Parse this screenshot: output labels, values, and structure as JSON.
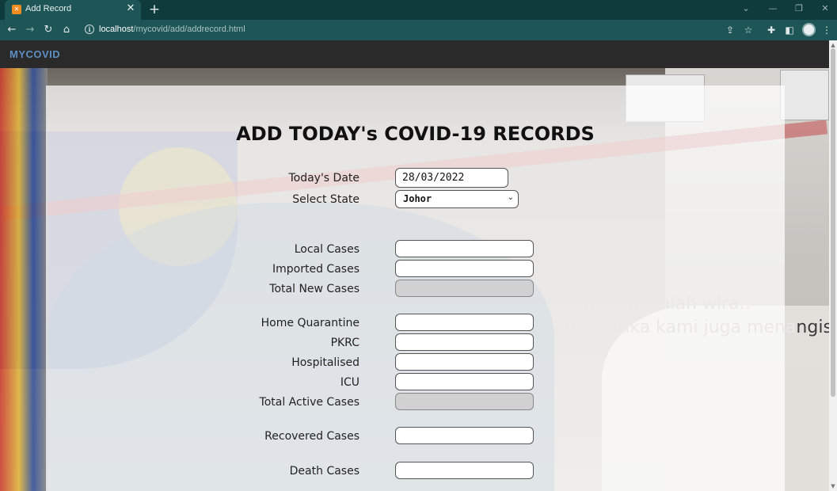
{
  "browser": {
    "tab_title": "Add Record",
    "tab_favicon": "xampp-icon",
    "url_host": "localhost",
    "url_path": "/mycovid/add/addrecord.html"
  },
  "navbar": {
    "brand": "MYCOVID"
  },
  "background": {
    "quote_line1": "“Kami bukanlah wira..",
    "quote_line2_light": "Ada ketika kami juga mena",
    "quote_line2_dark": "ngis”"
  },
  "form": {
    "title": "ADD TODAY's COVID-19 RECORDS",
    "date": {
      "label": "Today's Date",
      "value": "28/03/2022"
    },
    "state": {
      "label": "Select State",
      "value": "Johor"
    },
    "local_cases": {
      "label": "Local Cases",
      "value": ""
    },
    "imported_cases": {
      "label": "Imported Cases",
      "value": ""
    },
    "total_new_cases": {
      "label": "Total New Cases",
      "value": ""
    },
    "home_quarantine": {
      "label": "Home Quarantine",
      "value": ""
    },
    "pkrc": {
      "label": "PKRC",
      "value": ""
    },
    "hospitalised": {
      "label": "Hospitalised",
      "value": ""
    },
    "icu": {
      "label": "ICU",
      "value": ""
    },
    "total_active_cases": {
      "label": "Total Active Cases",
      "value": ""
    },
    "recovered_cases": {
      "label": "Recovered Cases",
      "value": ""
    },
    "death_cases": {
      "label": "Death Cases",
      "value": ""
    }
  }
}
